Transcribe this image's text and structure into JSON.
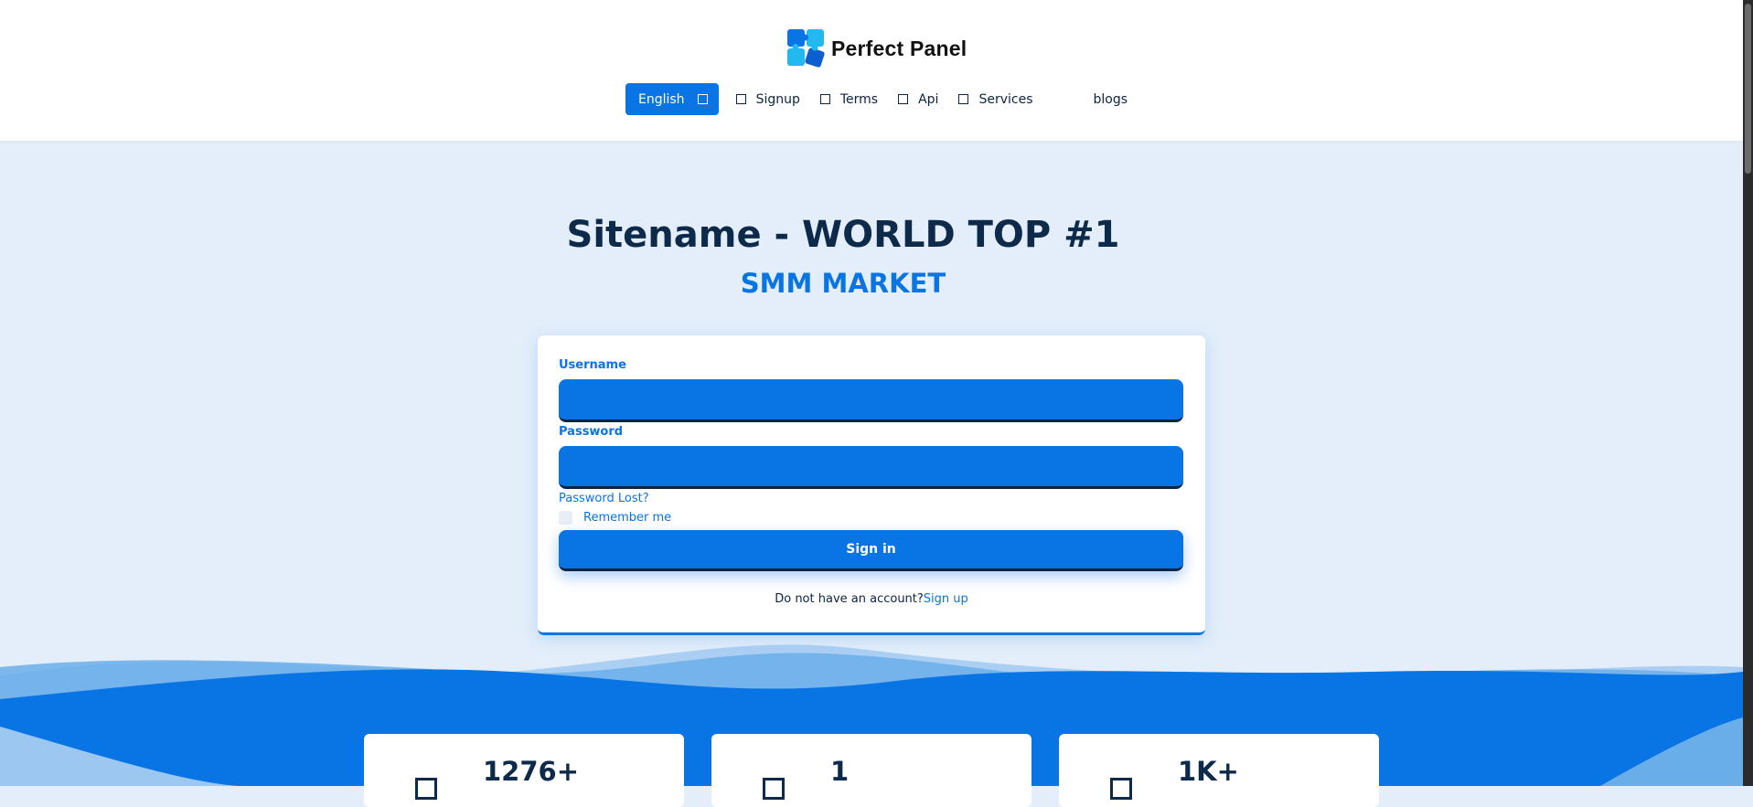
{
  "brand": {
    "name": "Perfect Panel"
  },
  "nav": {
    "language": "English",
    "items": [
      {
        "label": "Signup",
        "icon": "square-icon"
      },
      {
        "label": "Terms",
        "icon": "square-icon"
      },
      {
        "label": "Api",
        "icon": "square-icon"
      },
      {
        "label": "Services",
        "icon": "square-icon"
      }
    ],
    "blogs": "blogs"
  },
  "hero": {
    "title": "Sitename - WORLD TOP #1",
    "subtitle": "SMM MARKET"
  },
  "login": {
    "username_label": "Username",
    "username_value": "",
    "password_label": "Password",
    "password_value": "",
    "password_lost": "Password Lost?",
    "remember_me": "Remember me",
    "signin_label": "Sign in",
    "no_account_text": "Do not have an account?",
    "signup_link": "Sign up"
  },
  "stats": [
    {
      "value": "1276+"
    },
    {
      "value": "1"
    },
    {
      "value": "1K+"
    }
  ],
  "colors": {
    "accent": "#0974e4",
    "dark": "#0d2a4a",
    "background": "#e3eefa"
  }
}
